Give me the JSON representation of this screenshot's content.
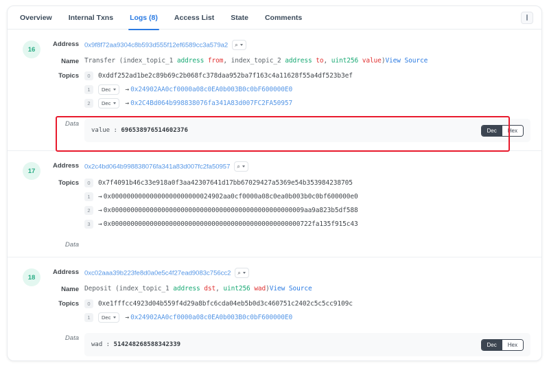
{
  "tabs": [
    {
      "label": "Overview",
      "active": false
    },
    {
      "label": "Internal Txns",
      "active": false
    },
    {
      "label": "Logs (8)",
      "active": true
    },
    {
      "label": "Access List",
      "active": false
    },
    {
      "label": "State",
      "active": false
    },
    {
      "label": "Comments",
      "active": false
    }
  ],
  "corner_button": {
    "name": "more-options-button"
  },
  "labels": {
    "address": "Address",
    "name": "Name",
    "topics": "Topics",
    "data": "Data",
    "view_source": "View Source",
    "dec": "Dec",
    "hex": "Hex",
    "arrow": "→"
  },
  "colors": {
    "accent": "#2a7ae2",
    "link": "#5596e6",
    "badge_bg": "#e3f7f0",
    "badge_text": "#27ab83",
    "green": "#19a974",
    "red": "#e03131",
    "highlight": "#e8192c",
    "dark_toggle": "#3c4551"
  },
  "logs": [
    {
      "index": "16",
      "address": "0x9f8f72aa9304c8b593d555f12ef6589cc3a579a2",
      "name_parts": [
        {
          "text": "Transfer (",
          "color": "gray"
        },
        {
          "text": "index_topic_1 ",
          "color": "gray"
        },
        {
          "text": "address",
          "color": "green"
        },
        {
          "text": " ",
          "color": "gray"
        },
        {
          "text": "from",
          "color": "red"
        },
        {
          "text": ", index_topic_2 ",
          "color": "gray"
        },
        {
          "text": "address",
          "color": "green"
        },
        {
          "text": " ",
          "color": "gray"
        },
        {
          "text": "to",
          "color": "red"
        },
        {
          "text": ", ",
          "color": "gray"
        },
        {
          "text": "uint256",
          "color": "green"
        },
        {
          "text": " ",
          "color": "gray"
        },
        {
          "text": "value",
          "color": "red"
        },
        {
          "text": ")",
          "color": "gray"
        }
      ],
      "topics": [
        {
          "idx": "0",
          "value": "0xddf252ad1be2c89b69c2b068fc378daa952ba7f163c4a11628f55a4df523b3ef",
          "has_dec": false,
          "has_arrow": false,
          "is_link": false
        },
        {
          "idx": "1",
          "value": "0x24902AA0cf0000a08c0EA0b003B0c0bF600000E0",
          "has_dec": true,
          "has_arrow": true,
          "is_link": true
        },
        {
          "idx": "2",
          "value": "0x2C4Bd064b998838076fa341A83d007FC2FA50957",
          "has_dec": true,
          "has_arrow": true,
          "is_link": true
        }
      ],
      "data": {
        "key": "value",
        "value": "696538976514602376",
        "show_toggle": true,
        "highlighted": true
      }
    },
    {
      "index": "17",
      "address": "0x2c4bd064b998838076fa341a83d007fc2fa50957",
      "name_parts": [],
      "topics": [
        {
          "idx": "0",
          "value": "0x7f4091b46c33e918a0f3aa42307641d17bb67029427a5369e54b353984238705",
          "has_dec": false,
          "has_arrow": false,
          "is_link": false
        },
        {
          "idx": "1",
          "value": "0x00000000000000000000000024902aa0cf0000a08c0ea0b003b0c0bf600000e0",
          "has_dec": false,
          "has_arrow": true,
          "is_link": false
        },
        {
          "idx": "2",
          "value": "0x00000000000000000000000000000000000000000000000009aa9a823b5df588",
          "has_dec": false,
          "has_arrow": true,
          "is_link": false
        },
        {
          "idx": "3",
          "value": "0x0000000000000000000000000000000000000000000000000722fa135f915c43",
          "has_dec": false,
          "has_arrow": true,
          "is_link": false
        }
      ],
      "data": {
        "key": "",
        "value": "",
        "show_toggle": false,
        "highlighted": false
      }
    },
    {
      "index": "18",
      "address": "0xc02aaa39b223fe8d0a0e5c4f27ead9083c756cc2",
      "name_parts": [
        {
          "text": "Deposit (",
          "color": "gray"
        },
        {
          "text": "index_topic_1 ",
          "color": "gray"
        },
        {
          "text": "address",
          "color": "green"
        },
        {
          "text": " ",
          "color": "gray"
        },
        {
          "text": "dst",
          "color": "red"
        },
        {
          "text": ", ",
          "color": "gray"
        },
        {
          "text": "uint256",
          "color": "green"
        },
        {
          "text": " ",
          "color": "gray"
        },
        {
          "text": "wad",
          "color": "red"
        },
        {
          "text": ")",
          "color": "gray"
        }
      ],
      "topics": [
        {
          "idx": "0",
          "value": "0xe1fffcc4923d04b559f4d29a8bfc6cda04eb5b0d3c460751c2402c5c5cc9109c",
          "has_dec": false,
          "has_arrow": false,
          "is_link": false
        },
        {
          "idx": "1",
          "value": "0x24902AA0cf0000a08c0EA0b003B0c0bF600000E0",
          "has_dec": true,
          "has_arrow": true,
          "is_link": true
        }
      ],
      "data": {
        "key": "wad",
        "value": "514248268588342339",
        "show_toggle": true,
        "highlighted": false
      }
    }
  ]
}
